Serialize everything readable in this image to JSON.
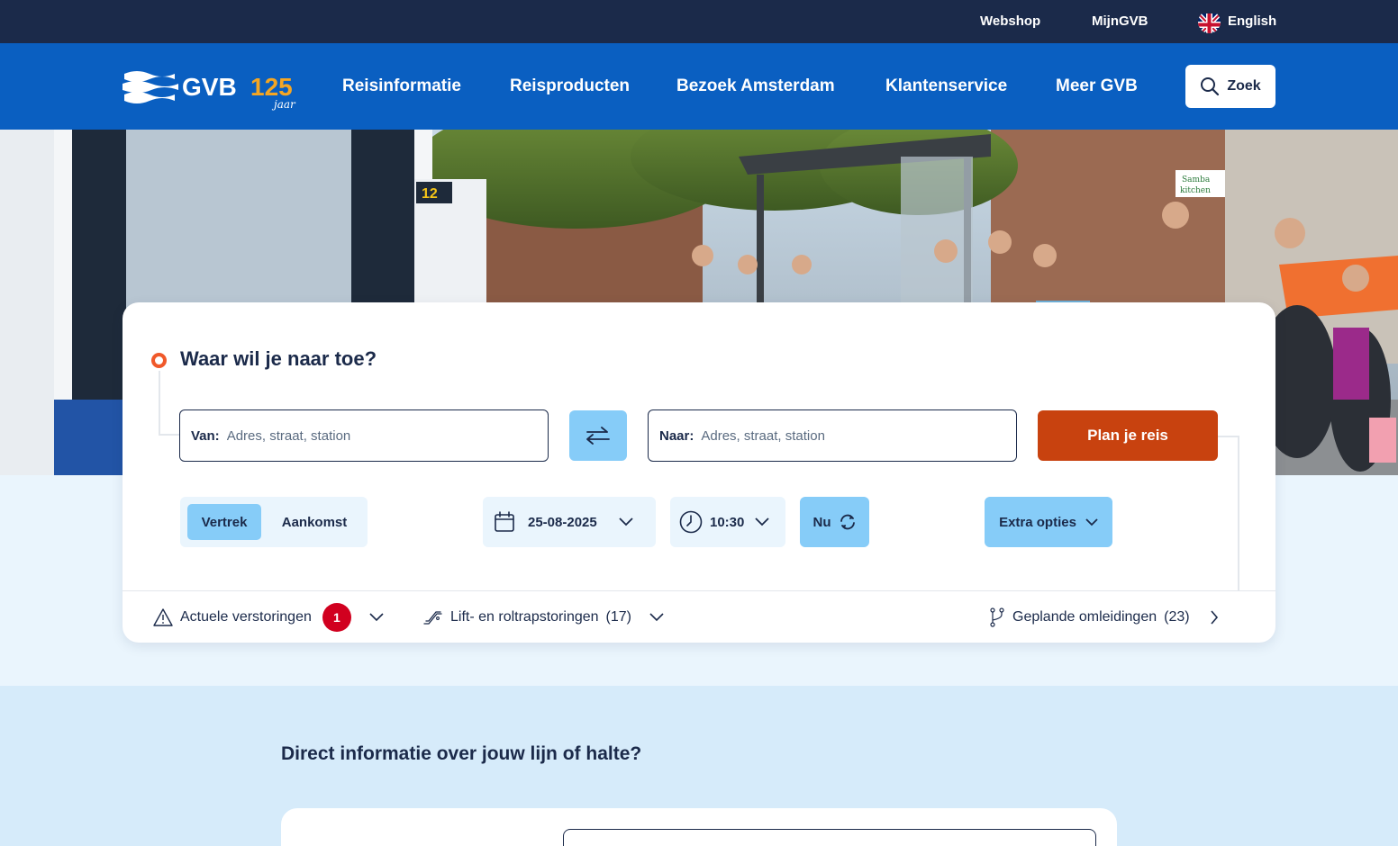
{
  "topbar": {
    "webshop": "Webshop",
    "mijngvb": "MijnGVB",
    "language": "English"
  },
  "brand": {
    "logo_text": "GVB",
    "anniversary": "125",
    "anniversary_sub": "jaar",
    "nav_blue": "#0a5fc1",
    "dark": "#1b2a4a",
    "accent_orange": "#c8420f",
    "light_blue": "#86ccf8"
  },
  "nav": {
    "items": [
      "Reisinformatie",
      "Reisproducten",
      "Bezoek Amsterdam",
      "Klantenservice",
      "Meer GVB"
    ],
    "search": "Zoek"
  },
  "planner": {
    "title": "Waar wil je naar toe?",
    "from_label": "Van:",
    "from_placeholder": "Adres, straat, station",
    "to_label": "Naar:",
    "to_placeholder": "Adres, straat, station",
    "plan_button": "Plan je reis",
    "departure": "Vertrek",
    "arrival": "Aankomst",
    "date": "25-08-2025",
    "time": "10:30",
    "now": "Nu",
    "extra_options": "Extra opties"
  },
  "status": {
    "disruptions_label": "Actuele verstoringen",
    "disruptions_count": "1",
    "lifts_label": "Lift- en roltrapstoringen",
    "lifts_count": "(17)",
    "detours_label": "Geplande omleidingen",
    "detours_count": "(23)"
  },
  "lower": {
    "title": "Direct informatie over jouw lijn of halte?"
  },
  "hero": {
    "tram_number": "12",
    "sign_left": "Samba",
    "sign_right": "kitchen"
  },
  "icons": [
    "flag-uk-icon",
    "search-icon",
    "swap-icon",
    "calendar-icon",
    "clock-icon",
    "refresh-icon",
    "chevron-down-icon",
    "warning-icon",
    "escalator-icon",
    "detour-icon",
    "chevron-right-icon"
  ]
}
